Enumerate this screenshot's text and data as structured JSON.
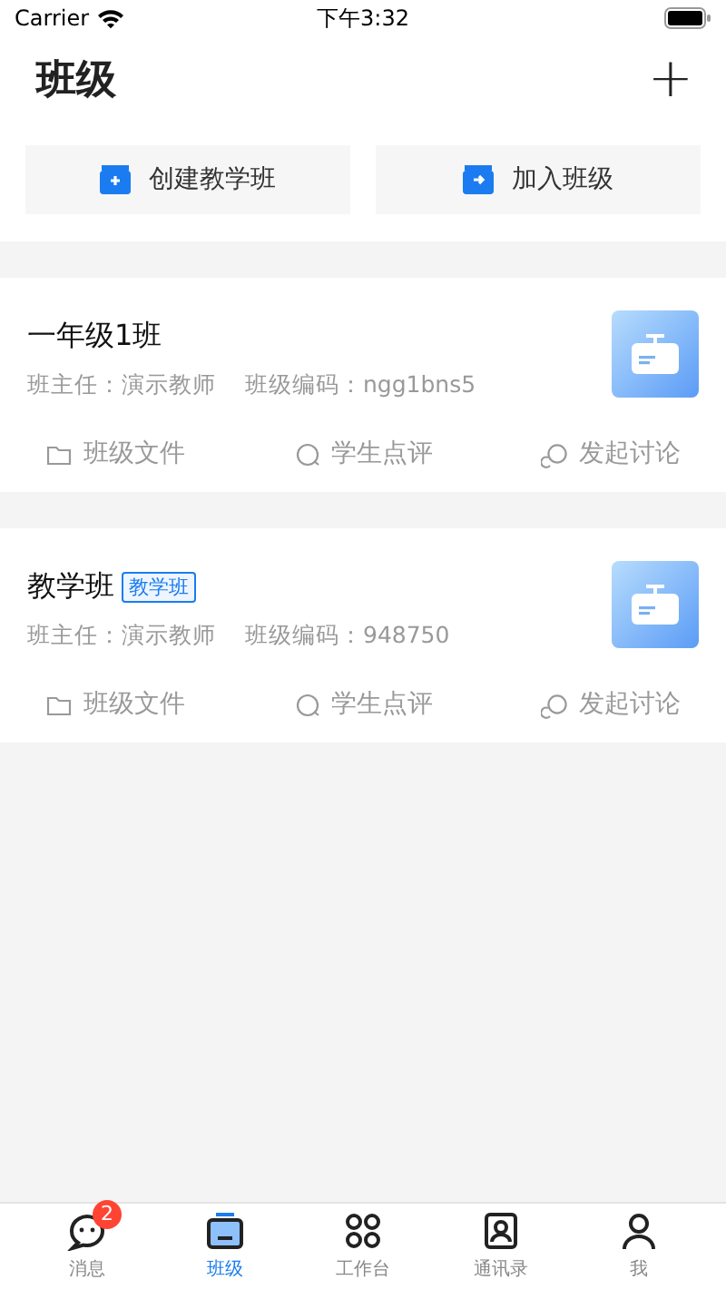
{
  "status_bar": {
    "carrier": "Carrier",
    "time": "下午3:32"
  },
  "header": {
    "title": "班级",
    "add": "+"
  },
  "actions": [
    {
      "kind": "create",
      "label": "创建教学班"
    },
    {
      "kind": "join",
      "label": "加入班级"
    }
  ],
  "classes": [
    {
      "name": "一年级1班",
      "teacher": "班主任：演示教师",
      "code": "班级编码：ngg1bns5",
      "links": [
        "班级文件",
        "学生点评",
        "发起讨论"
      ]
    },
    {
      "name": "教学班",
      "tag": "教学班",
      "teacher": "班主任：演示教师",
      "code": "班级编码：948750",
      "links": [
        "班级文件",
        "学生点评",
        "发起讨论"
      ]
    }
  ],
  "tab_bar": [
    {
      "kind": "message",
      "label": "消息",
      "badge": "2",
      "selected": false
    },
    {
      "kind": "class",
      "label": "班级",
      "selected": true
    },
    {
      "kind": "work",
      "label": "工作台",
      "selected": false
    },
    {
      "kind": "contacts",
      "label": "通讯录",
      "selected": false
    },
    {
      "kind": "me",
      "label": "我",
      "selected": false
    }
  ]
}
